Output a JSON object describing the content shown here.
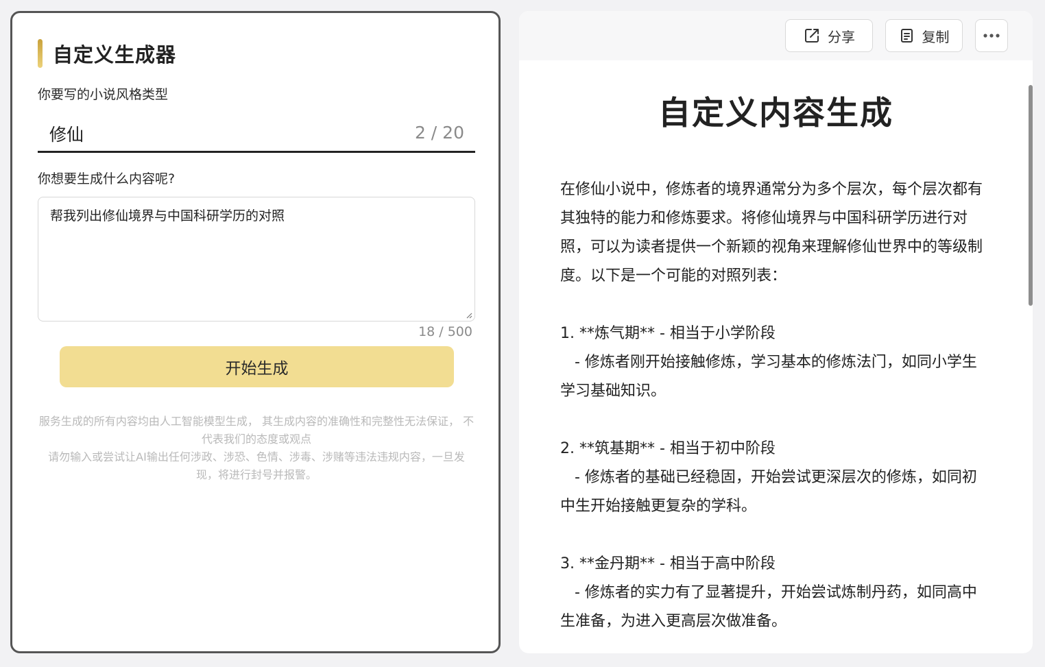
{
  "form": {
    "title": "自定义生成器",
    "style_label": "你要写的小说风格类型",
    "style_value": "修仙",
    "style_count": "2 / 20",
    "content_label": "你想要生成什么内容呢?",
    "content_value": "帮我列出修仙境界与中国科研学历的对照",
    "content_count": "18 / 500",
    "generate_label": "开始生成",
    "disclaimer_line1": "服务生成的所有内容均由人工智能模型生成， 其生成内容的准确性和完整性无法保证， 不代表我们的态度或观点",
    "disclaimer_line2": "请勿输入或尝试让AI输出任何涉政、涉恐、色情、涉毒、涉赌等违法违规内容，一旦发现，将进行封号并报警。"
  },
  "toolbar": {
    "share_label": "分享",
    "copy_label": "复制"
  },
  "document": {
    "title": "自定义内容生成",
    "body": "在修仙小说中，修炼者的境界通常分为多个层次，每个层次都有其独特的能力和修炼要求。将修仙境界与中国科研学历进行对照，可以为读者提供一个新颖的视角来理解修仙世界中的等级制度。以下是一个可能的对照列表：\n\n1. **炼气期** - 相当于小学阶段\n   - 修炼者刚开始接触修炼，学习基本的修炼法门，如同小学生学习基础知识。\n\n2. **筑基期** - 相当于初中阶段\n   - 修炼者的基础已经稳固，开始尝试更深层次的修炼，如同初中生开始接触更复杂的学科。\n\n3. **金丹期** - 相当于高中阶段\n   - 修炼者的实力有了显著提升，开始尝试炼制丹药，如同高中生准备，为进入更高层次做准备。"
  },
  "colors": {
    "accent": "#f2dd92",
    "accent_bar": "#c9a23c",
    "panel_border": "#555555",
    "muted_text": "#b9b9b9"
  },
  "icons": [
    "share-icon",
    "copy-icon",
    "more-icon"
  ]
}
